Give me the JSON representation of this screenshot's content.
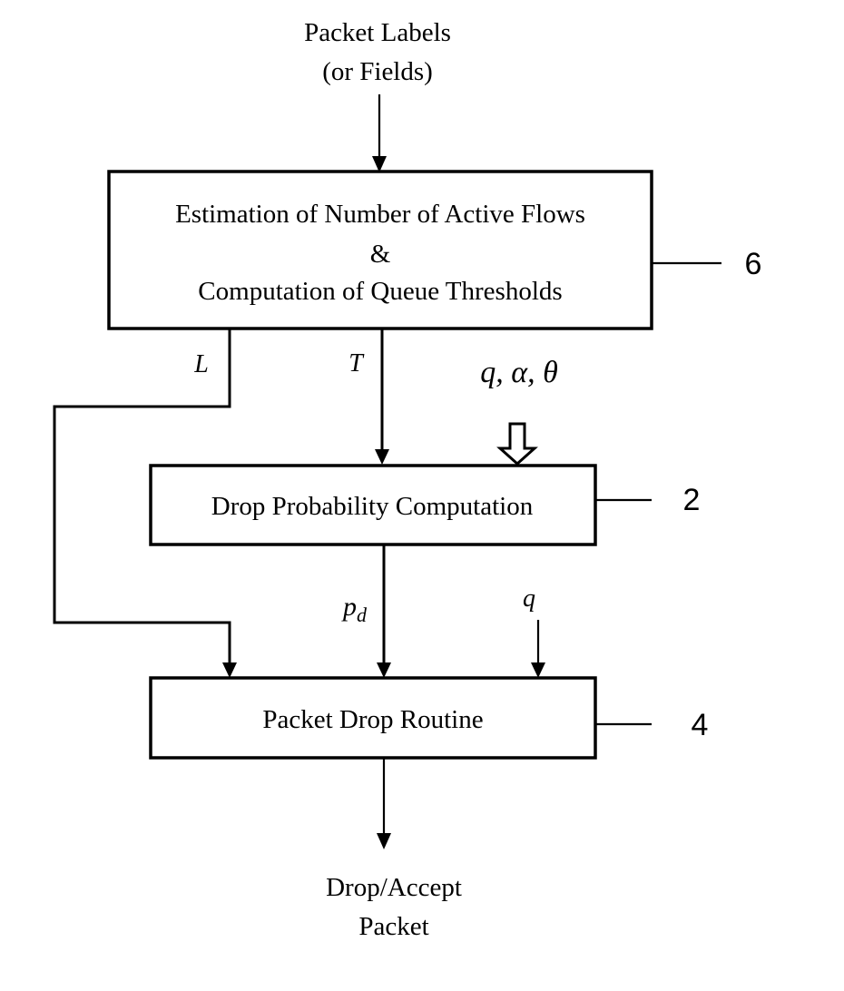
{
  "diagram": {
    "input": {
      "line1": "Packet Labels",
      "line2": "(or Fields)"
    },
    "blocks": [
      {
        "id": "6",
        "ref_label": "6",
        "lines": [
          "Estimation of Number of Active Flows",
          "&",
          "Computation of Queue Thresholds"
        ]
      },
      {
        "id": "2",
        "ref_label": "2",
        "lines": [
          "Drop Probability Computation"
        ]
      },
      {
        "id": "4",
        "ref_label": "4",
        "lines": [
          "Packet Drop Routine"
        ]
      }
    ],
    "signals": {
      "L": "L",
      "T": "T",
      "params": "q, α, θ",
      "pd_main": "p",
      "pd_sub": "d",
      "q": "q"
    },
    "edges": [
      {
        "from": "input",
        "to": "6",
        "label": ""
      },
      {
        "from": "6",
        "to": "2",
        "label": "T"
      },
      {
        "from": "6",
        "to": "4",
        "label": "L"
      },
      {
        "from": "params",
        "to": "2",
        "label": "q, α, θ",
        "style": "hollow"
      },
      {
        "from": "2",
        "to": "4",
        "label": "p_d"
      },
      {
        "from": "q",
        "to": "4",
        "label": "q"
      },
      {
        "from": "4",
        "to": "output",
        "label": ""
      }
    ],
    "output": {
      "line1": "Drop/Accept",
      "line2": "Packet"
    }
  }
}
